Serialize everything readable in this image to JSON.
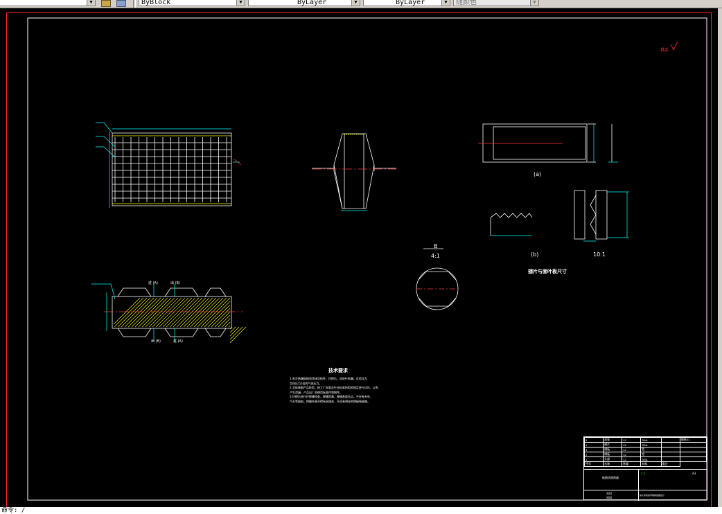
{
  "toolbar": {
    "color_label": "ByBlock",
    "linetype_label": "ByLayer",
    "lineweight_label": "ByLayer",
    "plotstyle_label": "随颜色"
  },
  "drawing": {
    "view_label_a": "(a)",
    "view_label_b": "(b)",
    "scale_10": "10:1",
    "detail_letter": "B",
    "detail_scale": "4:1",
    "side_caption": "翅片与面叶板尺寸",
    "surface_mark": "其余",
    "leader_labels": [
      "进 (A)",
      "出 (B)",
      "出 (B)",
      "进 (A)"
    ],
    "tech_title": "技术要求",
    "tech_lines": [
      "1.各冷热端板翅须涂抹导热件，钎焊后，须进行检漏，试验压为",
      "芯体压力1倍的气体压力。",
      "2.芯体装配产品检验，按工厂标准及行业标准的相关规定进行试压，以免",
      "产生泄漏，产品出厂须使用标准件和钢件。",
      "3.钎焊后进行钎焊缝检查，焊缝饱满，焊缝表面光洁，不应有夹杂、",
      "气孔等缺陷，焊缝外观不得有未熔合、不应有明显的焊接残留物。"
    ]
  },
  "title_block": {
    "rows": [
      [
        "5",
        "封条",
        "12",
        "304L",
        "",
        "图纸01"
      ],
      [
        "4",
        "翅片",
        "12",
        "304L",
        "",
        ""
      ],
      [
        "3",
        "隔板",
        "12",
        "铝",
        "",
        ""
      ],
      [
        "2",
        "侧板",
        "12",
        "铝",
        "",
        ""
      ],
      [
        "1",
        "头部",
        "12",
        "304L",
        "",
        ""
      ]
    ],
    "header": [
      "序号",
      "名称",
      "数量",
      "材料",
      "备注"
    ],
    "drawing_name": "板翅式换热器",
    "designer": "XXX",
    "checker": "XXX",
    "school_label": "某大学某某学院换热器设计",
    "scale": "1:1",
    "sheet": "A3"
  },
  "command": {
    "prompt": "命令: /"
  },
  "colors": {
    "frame": "#ff2a2a",
    "lines": "#ffffff",
    "dims": "#00ffff",
    "hatch": "#ffff00",
    "center": "#ff3b3b",
    "green_text": "#00ff00"
  }
}
